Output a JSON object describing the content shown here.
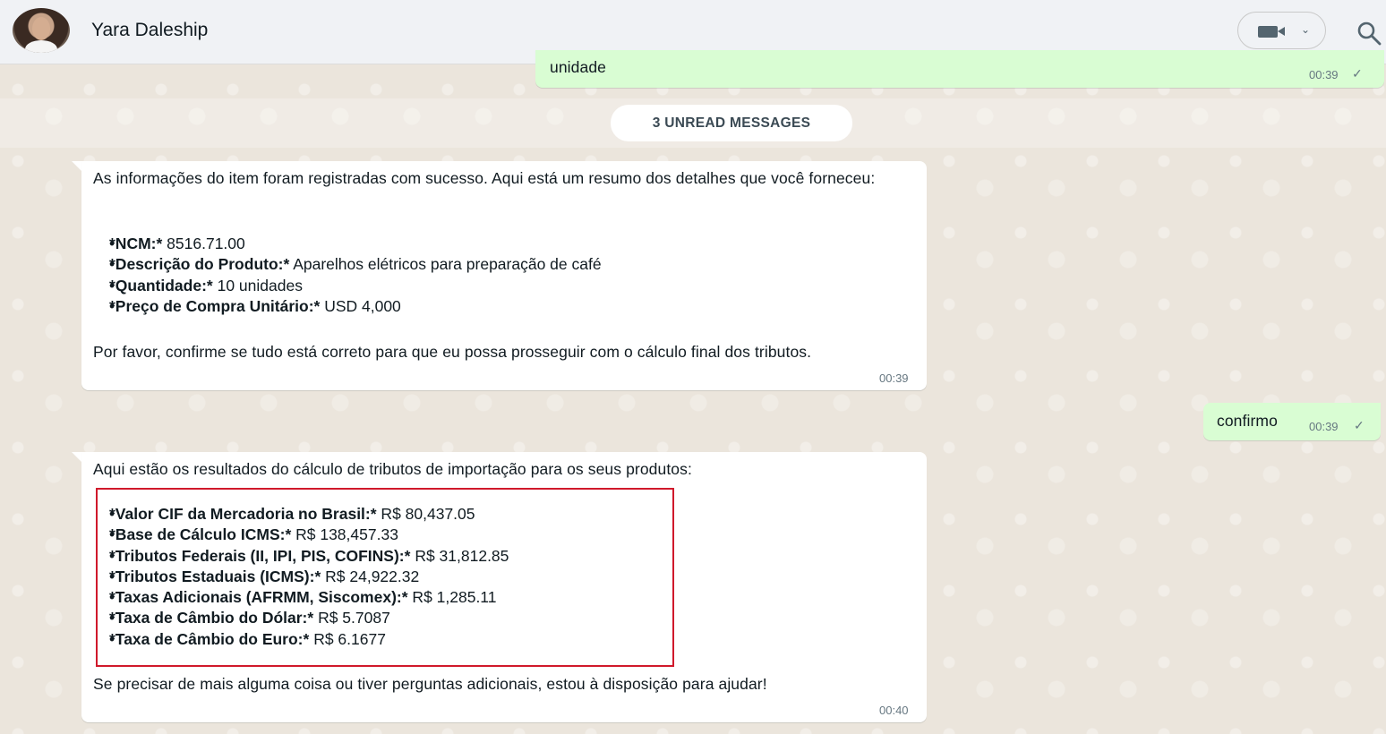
{
  "header": {
    "contact_name": "Yara Daleship"
  },
  "top_message": {
    "text": "unidade",
    "time": "00:39"
  },
  "unread_label": "3 UNREAD MESSAGES",
  "message1": {
    "intro": "As informações do item foram registradas com sucesso. Aqui está um resumo dos detalhes que você forneceu:",
    "items": [
      {
        "label": "*NCM:*",
        "value": " 8516.71.00"
      },
      {
        "label": "*Descrição do Produto:*",
        "value": " Aparelhos elétricos para preparação de café"
      },
      {
        "label": "*Quantidade:*",
        "value": " 10 unidades"
      },
      {
        "label": "*Preço de Compra Unitário:*",
        "value": " USD 4,000"
      }
    ],
    "outro": "Por favor, confirme se tudo está correto para que eu possa prosseguir com o cálculo final dos tributos.",
    "time": "00:39"
  },
  "reply": {
    "text": "confirmo",
    "time": "00:39"
  },
  "message2": {
    "intro": "Aqui estão os resultados do cálculo de tributos de importação para os seus produtos:",
    "items": [
      {
        "label": "*Valor CIF da Mercadoria no Brasil:*",
        "value": " R$ 80,437.05"
      },
      {
        "label": "*Base de Cálculo ICMS:*",
        "value": " R$ 138,457.33"
      },
      {
        "label": "*Tributos Federais (II, IPI, PIS, COFINS):*",
        "value": " R$ 31,812.85"
      },
      {
        "label": "*Tributos Estaduais (ICMS):*",
        "value": " R$ 24,922.32"
      },
      {
        "label": "*Taxas Adicionais (AFRMM, Siscomex):*",
        "value": " R$ 1,285.11"
      },
      {
        "label": "*Taxa de Câmbio do Dólar:*",
        "value": " R$ 5.7087"
      },
      {
        "label": "*Taxa de Câmbio do Euro:*",
        "value": " R$ 6.1677"
      }
    ],
    "outro": "Se precisar de mais alguma coisa ou tiver perguntas adicionais, estou à disposição para ajudar!",
    "time": "00:40"
  },
  "colors": {
    "outgoing_bubble": "#d9fdd3",
    "incoming_bubble": "#ffffff",
    "highlight_border": "#d0192b",
    "header_bg": "#f0f2f5"
  },
  "icons": {
    "video": "video-camera-icon",
    "search": "search-icon",
    "read_tick": "check-icon"
  }
}
